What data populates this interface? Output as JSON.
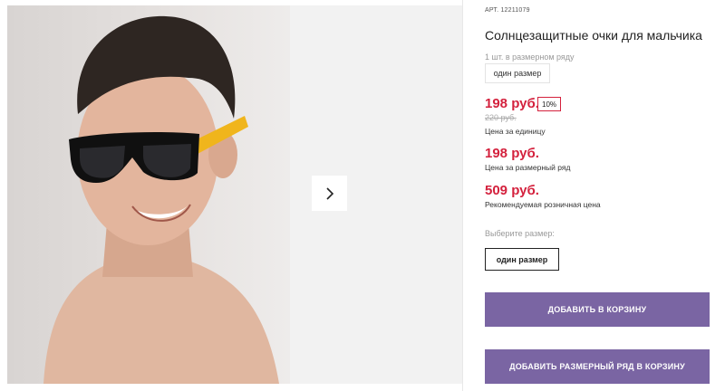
{
  "product": {
    "article_label": "АРТ.",
    "article_number": "12211079",
    "title": "Солнцезащитные очки для мальчика",
    "quantity_note": "1 шт. в размерном ряду",
    "size_chip": "один размер",
    "price": "198 руб.",
    "discount_badge": "10%",
    "old_price": "220 руб.",
    "unit_price_caption": "Цена за единицу",
    "row_price": "198 руб.",
    "row_price_caption": "Цена за размерный ряд",
    "retail_price": "509 руб.",
    "retail_price_caption": "Рекомендуемая розничная цена",
    "choose_size_label": "Выберите размер:",
    "size_option": "один размер",
    "add_to_cart": "ДОБАВИТЬ В КОРЗИНУ",
    "add_row_to_cart": "ДОБАВИТЬ РАЗМЕРНЫЙ РЯД В КОРЗИНУ"
  },
  "gallery": {
    "next_icon": "chevron-right-icon"
  },
  "colors": {
    "price": "#d4213d",
    "cta": "#7a65a3",
    "gallery_bg": "#f2f2f2"
  }
}
